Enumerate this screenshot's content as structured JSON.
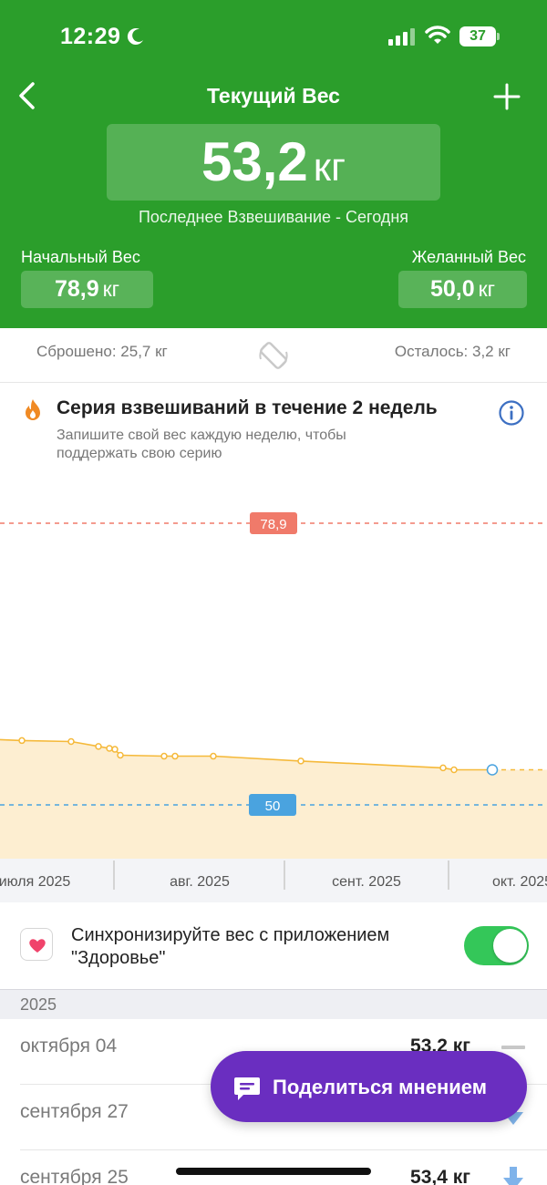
{
  "status_bar": {
    "time": "12:29",
    "battery": "37"
  },
  "nav": {
    "title": "Текущий Вес"
  },
  "current": {
    "value": "53,2",
    "unit": "кг",
    "last_weigh": "Последнее Взвешивание - Сегодня"
  },
  "start": {
    "label": "Начальный Вес",
    "value": "78,9",
    "unit": "кг"
  },
  "goal": {
    "label": "Желанный Вес",
    "value": "50,0",
    "unit": "кг"
  },
  "stats": {
    "lost": "Сброшено: 25,7 кг",
    "remaining": "Осталось: 3,2 кг"
  },
  "streak": {
    "title": "Серия взвешиваний в течение 2 недель",
    "subtitle": "Запишите свой вес каждую неделю, чтобы поддержать свою серию"
  },
  "chart_data": {
    "type": "area",
    "reference_lines": [
      {
        "label": "78,9",
        "value": 78.9,
        "color": "#f07a6a"
      },
      {
        "label": "50",
        "value": 50,
        "color": "#4aa3df"
      }
    ],
    "x_ticks": [
      "июля 2025",
      "авг. 2025",
      "сент. 2025",
      "окт. 2025"
    ],
    "points": [
      {
        "date": "2025-07-10",
        "value": 56.6
      },
      {
        "date": "2025-07-19",
        "value": 56.5
      },
      {
        "date": "2025-07-24",
        "value": 56.0
      },
      {
        "date": "2025-07-26",
        "value": 55.8
      },
      {
        "date": "2025-07-27",
        "value": 55.7
      },
      {
        "date": "2025-07-28",
        "value": 55.1
      },
      {
        "date": "2025-08-05",
        "value": 55.0
      },
      {
        "date": "2025-08-07",
        "value": 55.0
      },
      {
        "date": "2025-08-14",
        "value": 55.0
      },
      {
        "date": "2025-08-30",
        "value": 54.5
      },
      {
        "date": "2025-09-25",
        "value": 53.8
      },
      {
        "date": "2025-09-27",
        "value": 53.6
      },
      {
        "date": "2025-10-04",
        "value": 53.6
      }
    ],
    "line_color": "#f5b93a",
    "fill_color": "#fdebc9"
  },
  "sync": {
    "text": "Синхронизируйте вес с приложением \"Здоровье\"",
    "enabled": true
  },
  "history": {
    "year": "2025",
    "entries": [
      {
        "date": "октября 04",
        "weight": "53,2 кг",
        "trend": "flat"
      },
      {
        "date": "сентября 27",
        "weight": "",
        "trend": "down"
      },
      {
        "date": "сентября 25",
        "weight": "53,4 кг",
        "trend": "down"
      }
    ]
  },
  "feedback": {
    "label": "Поделиться мнением"
  }
}
